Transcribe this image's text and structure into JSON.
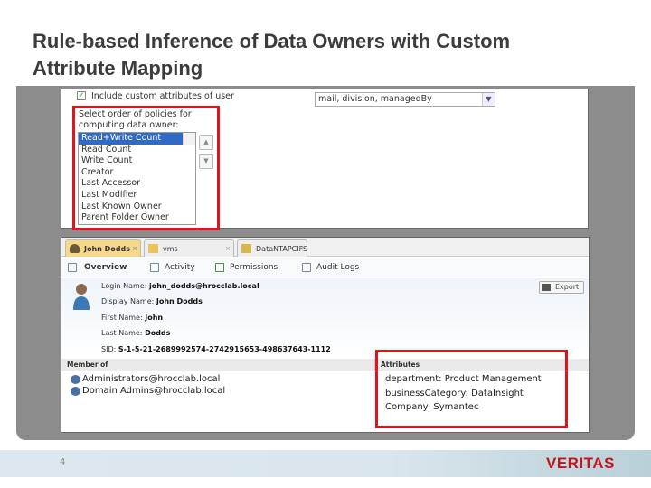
{
  "title": [
    "Rule-based Inference of Data Owners with Custom",
    "Attribute Mapping"
  ],
  "settings": {
    "include_custom_label": "Include custom attributes of user",
    "include_custom_checked": true,
    "attributes_combo_value": "mail, division, managedBy",
    "policy_order_label": "Select order of policies for computing data owner:",
    "policies": [
      "Read+Write Count",
      "Read Count",
      "Write Count",
      "Creator",
      "Last Accessor",
      "Last Modifier",
      "Last Known Owner",
      "Parent Folder Owner"
    ],
    "selected_policy": "Read+Write Count"
  },
  "tabs": [
    {
      "label": "John Dodds"
    },
    {
      "label": "vms"
    },
    {
      "label": "DataNTAPCIFS"
    }
  ],
  "toolbar": [
    "Overview",
    "Activity",
    "Permissions",
    "Audit Logs"
  ],
  "user": {
    "login_label": "Login Name:",
    "login": "john_dodds@hrocclab.local",
    "display_label": "Display Name:",
    "display": "John Dodds",
    "first_label": "First Name:",
    "first": "John",
    "last_label": "Last Name:",
    "last": "Dodds",
    "sid_label": "SID:",
    "sid": "S-1-5-21-2689992574-2742915653-498637643-1112"
  },
  "export_label": "Export",
  "member_of": {
    "header": "Member of",
    "items": [
      "Administrators@hrocclab.local",
      "Domain Admins@hrocclab.local"
    ]
  },
  "attributes": {
    "header": "Attributes",
    "items": [
      "department: Product Management",
      "businessCategory: DataInsight",
      "Company: Symantec"
    ]
  },
  "footer": {
    "page": "4",
    "logo": "VERITAS"
  },
  "colors": {
    "highlight": "#e0141e",
    "selection": "#3169c6",
    "brand": "#c4161c"
  }
}
